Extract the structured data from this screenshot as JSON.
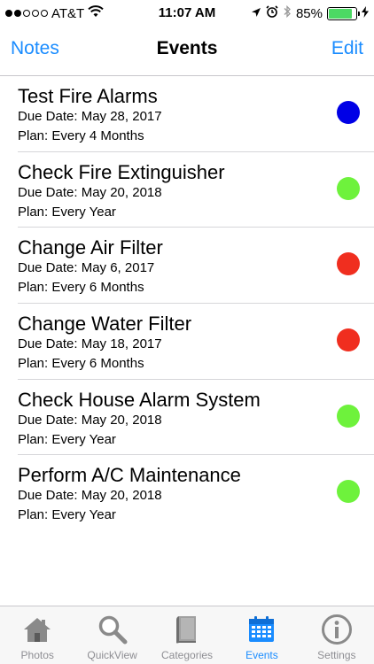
{
  "status_bar": {
    "carrier": "AT&T",
    "time": "11:07 AM",
    "battery": "85%",
    "signal_filled": 2,
    "signal_total": 5
  },
  "nav": {
    "back_label": "Notes",
    "title": "Events",
    "edit_label": "Edit"
  },
  "events": [
    {
      "title": "Test Fire Alarms",
      "due": "Due Date: May 28, 2017",
      "plan": "Plan: Every 4 Months",
      "status_color": "#0000e6"
    },
    {
      "title": "Check Fire Extinguisher",
      "due": "Due Date: May 20, 2018",
      "plan": "Plan: Every Year",
      "status_color": "#6ef23c"
    },
    {
      "title": "Change Air Filter",
      "due": "Due Date: May 6, 2017",
      "plan": "Plan: Every 6 Months",
      "status_color": "#f02e1f"
    },
    {
      "title": "Change Water Filter",
      "due": "Due Date: May 18, 2017",
      "plan": "Plan: Every 6 Months",
      "status_color": "#f02e1f"
    },
    {
      "title": "Check House Alarm System",
      "due": "Due Date: May 20, 2018",
      "plan": "Plan: Every Year",
      "status_color": "#6ef23c"
    },
    {
      "title": "Perform A/C Maintenance",
      "due": "Due Date: May 20, 2018",
      "plan": "Plan: Every Year",
      "status_color": "#6ef23c"
    }
  ],
  "tabs": [
    {
      "label": "Photos",
      "icon": "house-icon",
      "active": false
    },
    {
      "label": "QuickView",
      "icon": "magnifier-icon",
      "active": false
    },
    {
      "label": "Categories",
      "icon": "book-icon",
      "active": false
    },
    {
      "label": "Events",
      "icon": "calendar-icon",
      "active": true
    },
    {
      "label": "Settings",
      "icon": "info-icon",
      "active": false
    }
  ],
  "colors": {
    "accent": "#1a8cff",
    "inactive_tab": "#8e8e93"
  }
}
